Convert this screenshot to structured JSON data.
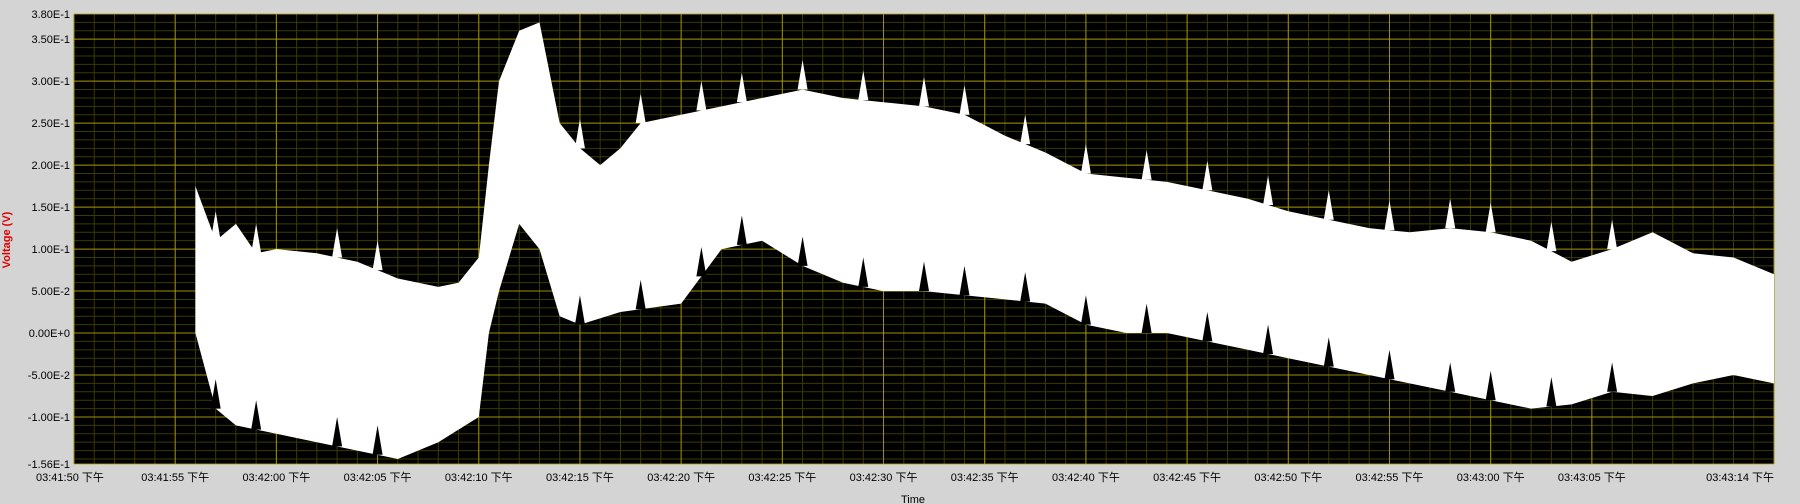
{
  "chart_data": {
    "type": "area",
    "xlabel": "Time",
    "ylabel": "Voltage (V)",
    "ylim": [
      -0.156,
      0.38
    ],
    "xlim": [
      "03:41:50",
      "03:43:14"
    ],
    "y_ticks": [
      {
        "value": 0.38,
        "label": "3.80E-1"
      },
      {
        "value": 0.35,
        "label": "3.50E-1"
      },
      {
        "value": 0.3,
        "label": "3.00E-1"
      },
      {
        "value": 0.25,
        "label": "2.50E-1"
      },
      {
        "value": 0.2,
        "label": "2.00E-1"
      },
      {
        "value": 0.15,
        "label": "1.50E-1"
      },
      {
        "value": 0.1,
        "label": "1.00E-1"
      },
      {
        "value": 0.05,
        "label": "5.00E-2"
      },
      {
        "value": 0.0,
        "label": "0.00E+0"
      },
      {
        "value": -0.05,
        "label": "-5.00E-2"
      },
      {
        "value": -0.1,
        "label": "-1.00E-1"
      },
      {
        "value": -0.156,
        "label": "-1.56E-1"
      }
    ],
    "x_ticks": [
      {
        "value": "03:41:50",
        "label": "03:41:50 下午"
      },
      {
        "value": "03:41:55",
        "label": "03:41:55 下午"
      },
      {
        "value": "03:42:00",
        "label": "03:42:00 下午"
      },
      {
        "value": "03:42:05",
        "label": "03:42:05 下午"
      },
      {
        "value": "03:42:10",
        "label": "03:42:10 下午"
      },
      {
        "value": "03:42:15",
        "label": "03:42:15 下午"
      },
      {
        "value": "03:42:20",
        "label": "03:42:20 下午"
      },
      {
        "value": "03:42:25",
        "label": "03:42:25 下午"
      },
      {
        "value": "03:42:30",
        "label": "03:42:30 下午"
      },
      {
        "value": "03:42:35",
        "label": "03:42:35 下午"
      },
      {
        "value": "03:42:40",
        "label": "03:42:40 下午"
      },
      {
        "value": "03:42:45",
        "label": "03:42:45 下午"
      },
      {
        "value": "03:42:50",
        "label": "03:42:50 下午"
      },
      {
        "value": "03:42:55",
        "label": "03:42:55 下午"
      },
      {
        "value": "03:43:00",
        "label": "03:43:00 下午"
      },
      {
        "value": "03:43:05",
        "label": "03:43:05 下午"
      },
      {
        "value": "03:43:14",
        "label": "03:43:14 下午"
      }
    ],
    "grid": true,
    "colors": {
      "plot_bg": "#000000",
      "grid_major": "#b8a800",
      "grid_minor": "#3a3a00",
      "signal": "#ffffff",
      "frame": "#d4d4d4",
      "ylabel": "#e00000"
    },
    "series": [
      {
        "upper": [
          [
            "03:41:56",
            0.175
          ],
          [
            "03:41:57",
            0.11
          ],
          [
            "03:41:58",
            0.13
          ],
          [
            "03:41:59",
            0.095
          ],
          [
            "03:42:00",
            0.1
          ],
          [
            "03:42:02",
            0.095
          ],
          [
            "03:42:04",
            0.085
          ],
          [
            "03:42:06",
            0.065
          ],
          [
            "03:42:08",
            0.055
          ],
          [
            "03:42:09",
            0.06
          ],
          [
            "03:42:10",
            0.09
          ],
          [
            "03:42:10.5",
            0.2
          ],
          [
            "03:42:11",
            0.3
          ],
          [
            "03:42:12",
            0.36
          ],
          [
            "03:42:13",
            0.37
          ],
          [
            "03:42:14",
            0.25
          ],
          [
            "03:42:15",
            0.22
          ],
          [
            "03:42:16",
            0.2
          ],
          [
            "03:42:17",
            0.22
          ],
          [
            "03:42:18",
            0.25
          ],
          [
            "03:42:20",
            0.26
          ],
          [
            "03:42:22",
            0.27
          ],
          [
            "03:42:24",
            0.28
          ],
          [
            "03:42:26",
            0.29
          ],
          [
            "03:42:28",
            0.28
          ],
          [
            "03:42:30",
            0.275
          ],
          [
            "03:42:32",
            0.27
          ],
          [
            "03:42:34",
            0.26
          ],
          [
            "03:42:36",
            0.235
          ],
          [
            "03:42:38",
            0.215
          ],
          [
            "03:42:40",
            0.19
          ],
          [
            "03:42:42",
            0.185
          ],
          [
            "03:42:44",
            0.18
          ],
          [
            "03:42:46",
            0.17
          ],
          [
            "03:42:48",
            0.16
          ],
          [
            "03:42:50",
            0.145
          ],
          [
            "03:42:52",
            0.135
          ],
          [
            "03:42:54",
            0.125
          ],
          [
            "03:42:56",
            0.12
          ],
          [
            "03:42:58",
            0.125
          ],
          [
            "03:43:00",
            0.12
          ],
          [
            "03:43:02",
            0.11
          ],
          [
            "03:43:04",
            0.085
          ],
          [
            "03:43:06",
            0.1
          ],
          [
            "03:43:08",
            0.12
          ],
          [
            "03:43:10",
            0.095
          ],
          [
            "03:43:12",
            0.09
          ],
          [
            "03:43:14",
            0.07
          ]
        ],
        "lower": [
          [
            "03:41:56",
            0.0
          ],
          [
            "03:41:57",
            -0.09
          ],
          [
            "03:41:58",
            -0.11
          ],
          [
            "03:42:00",
            -0.12
          ],
          [
            "03:42:02",
            -0.13
          ],
          [
            "03:42:04",
            -0.14
          ],
          [
            "03:42:06",
            -0.15
          ],
          [
            "03:42:08",
            -0.13
          ],
          [
            "03:42:09",
            -0.115
          ],
          [
            "03:42:10",
            -0.1
          ],
          [
            "03:42:10.5",
            0.0
          ],
          [
            "03:42:11",
            0.05
          ],
          [
            "03:42:12",
            0.13
          ],
          [
            "03:42:13",
            0.1
          ],
          [
            "03:42:14",
            0.02
          ],
          [
            "03:42:15",
            0.01
          ],
          [
            "03:42:17",
            0.025
          ],
          [
            "03:42:20",
            0.035
          ],
          [
            "03:42:22",
            0.1
          ],
          [
            "03:42:24",
            0.11
          ],
          [
            "03:42:26",
            0.08
          ],
          [
            "03:42:28",
            0.06
          ],
          [
            "03:42:30",
            0.05
          ],
          [
            "03:42:32",
            0.05
          ],
          [
            "03:42:34",
            0.045
          ],
          [
            "03:42:36",
            0.04
          ],
          [
            "03:42:38",
            0.035
          ],
          [
            "03:42:40",
            0.01
          ],
          [
            "03:42:42",
            0.0
          ],
          [
            "03:42:44",
            0.0
          ],
          [
            "03:42:46",
            -0.01
          ],
          [
            "03:42:48",
            -0.02
          ],
          [
            "03:42:50",
            -0.03
          ],
          [
            "03:42:52",
            -0.04
          ],
          [
            "03:42:54",
            -0.05
          ],
          [
            "03:42:56",
            -0.06
          ],
          [
            "03:42:58",
            -0.07
          ],
          [
            "03:43:00",
            -0.08
          ],
          [
            "03:43:02",
            -0.09
          ],
          [
            "03:43:04",
            -0.085
          ],
          [
            "03:43:06",
            -0.07
          ],
          [
            "03:43:08",
            -0.075
          ],
          [
            "03:43:10",
            -0.06
          ],
          [
            "03:43:12",
            -0.05
          ],
          [
            "03:43:14",
            -0.06
          ]
        ],
        "spikes": [
          "03:41:57",
          "03:41:59",
          "03:42:03",
          "03:42:05",
          "03:42:15",
          "03:42:18",
          "03:42:21",
          "03:42:23",
          "03:42:26",
          "03:42:29",
          "03:42:32",
          "03:42:34",
          "03:42:37",
          "03:42:40",
          "03:42:43",
          "03:42:46",
          "03:42:49",
          "03:42:52",
          "03:42:55",
          "03:42:58",
          "03:43:00",
          "03:43:03",
          "03:43:06"
        ]
      }
    ]
  }
}
